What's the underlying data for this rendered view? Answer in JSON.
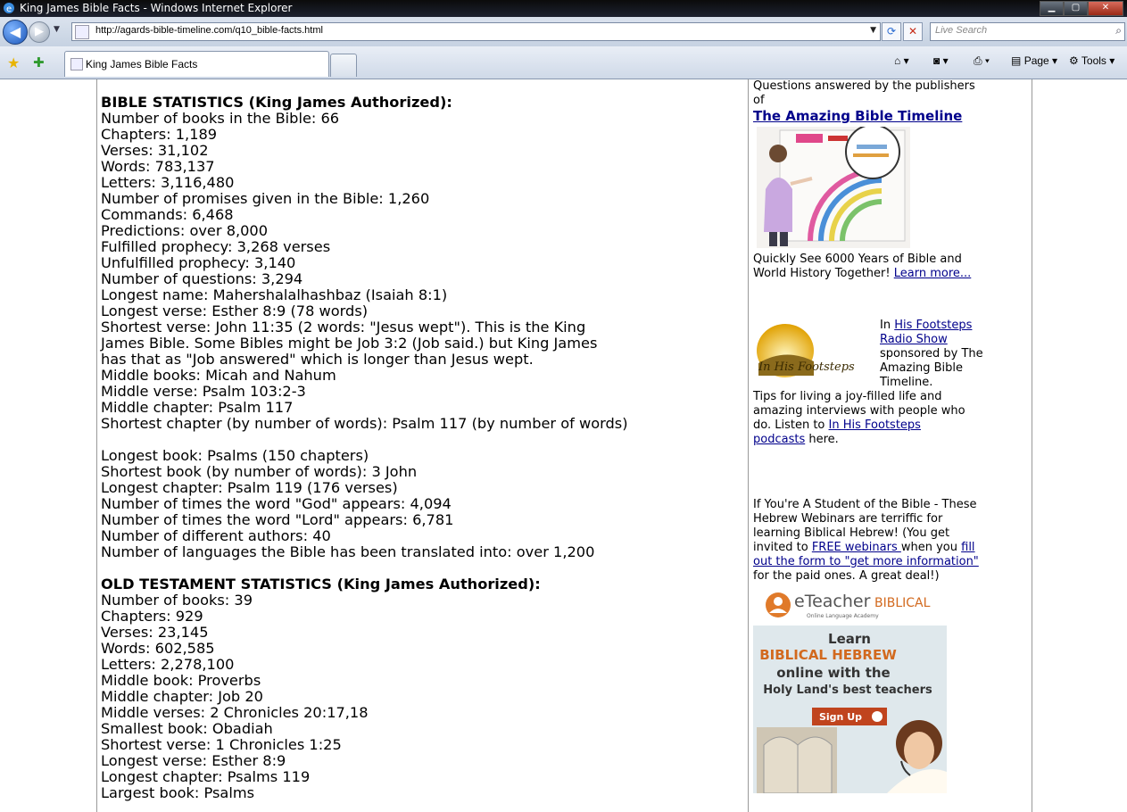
{
  "window": {
    "title": "King James Bible Facts - Windows Internet Explorer"
  },
  "nav": {
    "url": "http://agards-bible-timeline.com/q10_bible-facts.html",
    "search_placeholder": "Live Search"
  },
  "tabs": {
    "active_label": "King James Bible Facts",
    "page_label": "Page",
    "tools_label": "Tools"
  },
  "main": {
    "bible_heading": "BIBLE STATISTICS (King James Authorized):",
    "bible_lines": [
      "Number of books in the Bible: 66",
      "Chapters: 1,189",
      "Verses: 31,102",
      "Words: 783,137",
      "Letters: 3,116,480",
      "Number of promises given in the Bible: 1,260",
      "Commands: 6,468",
      "Predictions: over 8,000",
      "Fulfilled prophecy: 3,268 verses",
      "Unfulfilled prophecy: 3,140",
      "Number of questions: 3,294",
      "Longest name: Mahershalalhashbaz (Isaiah 8:1)",
      "Longest verse: Esther 8:9 (78 words)",
      "Shortest verse: John 11:35 (2 words: \"Jesus wept\").  This is the King",
      "James Bible.  Some Bibles might be Job 3:2 (Job said.) but King James",
      "has that as \"Job answered\" which is longer than Jesus wept.",
      "Middle books: Micah and Nahum",
      "Middle verse: Psalm 103:2-3",
      "Middle chapter: Psalm 117",
      "Shortest chapter (by number of words): Psalm 117 (by number of words)"
    ],
    "bible_lines2": [
      "Longest book: Psalms (150 chapters)",
      "Shortest book (by number of words): 3 John",
      "Longest chapter: Psalm 119 (176 verses)",
      "Number of times the word \"God\" appears: 4,094",
      "Number of times the word \"Lord\" appears: 6,781",
      "Number of different authors: 40",
      "Number of languages the Bible has been translated into: over 1,200"
    ],
    "ot_heading": "OLD TESTAMENT STATISTICS (King James Authorized):",
    "ot_lines": [
      "Number of books: 39",
      "Chapters: 929",
      "Verses: 23,145",
      "Words: 602,585",
      "Letters: 2,278,100",
      "Middle book: Proverbs",
      "Middle chapter: Job 20",
      "Middle verses: 2 Chronicles 20:17,18",
      "Smallest book: Obadiah",
      "Shortest verse: 1 Chronicles 1:25",
      "Longest verse: Esther 8:9",
      "Longest chapter: Psalms 119",
      "Largest book: Psalms"
    ]
  },
  "sidebar": {
    "intro": "Questions answered by the publishers of",
    "timeline_link": "The Amazing Bible Timeline",
    "timeline_desc": "Quickly See 6000 Years of Bible and World History Together! ",
    "learn_more": "Learn more...",
    "in_text": "In ",
    "footsteps_link": "His Footsteps Radio Show",
    "sponsored": " sponsored by The Amazing Bible Timeline.",
    "tips": "Tips for living a joy-filled life and amazing interviews with people who do.  Listen to ",
    "podcasts_link": "In His Footsteps podcasts",
    "here": " here.",
    "logo_text": "In His Footsteps",
    "student": "If You're A Student of the Bible - These Hebrew Webinars are terriffic for learning Biblical Hebrew! (You get invited to ",
    "free_link": "FREE webinars ",
    "when_you": "when you ",
    "fill_link": "fill out the form to \"get more information\"",
    "paid": " for the paid ones.  A great deal!)",
    "ad": {
      "brand1": "eTeacher",
      "brand2": "BIBLICAL",
      "tagline": "Online Language Academy",
      "learn": "Learn",
      "hebrew": "BIBLICAL HEBREW",
      "online": "online with the",
      "teachers": "Holy Land's best teachers",
      "signup": "Sign Up"
    }
  }
}
